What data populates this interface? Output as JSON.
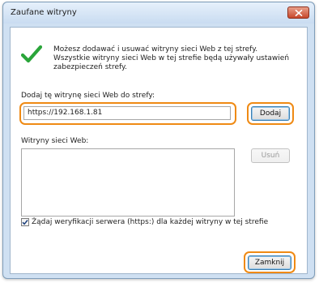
{
  "window": {
    "title": "Zaufane witryny"
  },
  "info": {
    "text": "Możesz dodawać i usuwać witryny sieci Web z tej strefy. Wszystkie witryny sieci Web w tej strefie będą używały ustawień zabezpieczeń strefy."
  },
  "add_zone": {
    "label": "Dodaj tę witrynę sieci Web do strefy:",
    "value": "https://192.168.1.81",
    "add_button": "Dodaj"
  },
  "sites": {
    "label": "Witryny sieci Web:",
    "items": [],
    "remove_button": "Usuń"
  },
  "verification": {
    "label": "Żądaj weryfikacji serwera (https:) dla każdej witryny w tej strefie",
    "checked": true
  },
  "footer": {
    "close_button": "Zamknij"
  },
  "colors": {
    "highlight": "#ef8a14",
    "check_green": "#2aa53a"
  },
  "icons": {
    "status": "checkmark-icon",
    "close": "close-icon"
  }
}
